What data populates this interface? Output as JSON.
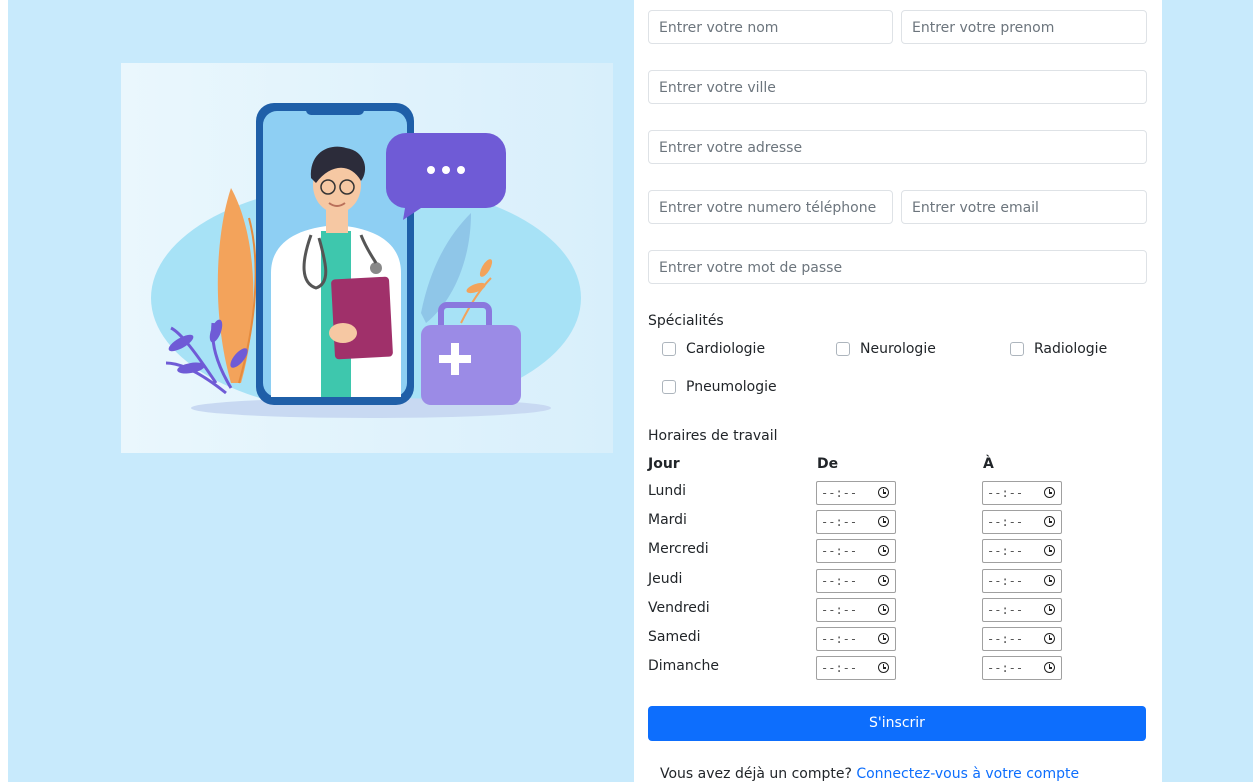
{
  "form": {
    "nom_placeholder": "Entrer votre nom",
    "prenom_placeholder": "Entrer votre prenom",
    "ville_placeholder": "Entrer votre ville",
    "adresse_placeholder": "Entrer votre adresse",
    "telephone_placeholder": "Entrer votre numero téléphone",
    "email_placeholder": "Entrer votre email",
    "password_placeholder": "Entrer votre mot de passe"
  },
  "specialites": {
    "title": "Spécialités",
    "options": [
      "Cardiologie",
      "Neurologie",
      "Radiologie",
      "Pneumologie"
    ]
  },
  "horaires": {
    "title": "Horaires de travail",
    "col_jour": "Jour",
    "col_de": "De",
    "col_a": "À",
    "time_placeholder": "--:--",
    "days": [
      "Lundi",
      "Mardi",
      "Mercredi",
      "Jeudi",
      "Vendredi",
      "Samedi",
      "Dimanche"
    ]
  },
  "submit_label": "S'inscrir",
  "footer": {
    "text": "Vous avez déjà un compte?",
    "link": "Connectez-vous à votre compte"
  },
  "colors": {
    "page_bg": "#c8eafc",
    "accent": "#0d6efd"
  }
}
